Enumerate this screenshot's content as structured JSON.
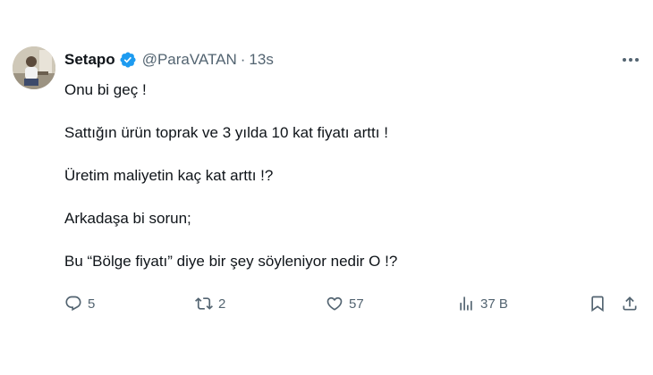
{
  "tweet": {
    "display_name": "Setapo",
    "handle": "@ParaVATAN",
    "separator": "·",
    "time": "13s",
    "lines": [
      "Onu bi geç !",
      "Sattığın ürün toprak ve 3 yılda 10 kat fiyatı arttı !",
      "Üretim maliyetin kaç kat arttı !?",
      "Arkadaşa bi sorun;",
      "Bu “Bölge fiyatı” diye bir şey söyleniyor nedir O !?"
    ],
    "replies": "5",
    "retweets": "2",
    "likes": "57",
    "views": "37 B"
  },
  "icons": {
    "verified": "verified-badge-icon",
    "more": "more-options-icon",
    "reply": "reply-icon",
    "retweet": "retweet-icon",
    "like": "heart-icon",
    "views": "views-icon",
    "bookmark": "bookmark-icon",
    "share": "share-icon"
  },
  "colors": {
    "text": "#0f1419",
    "secondary": "#536471",
    "verified": "#1d9bf0",
    "background": "#ffffff"
  }
}
